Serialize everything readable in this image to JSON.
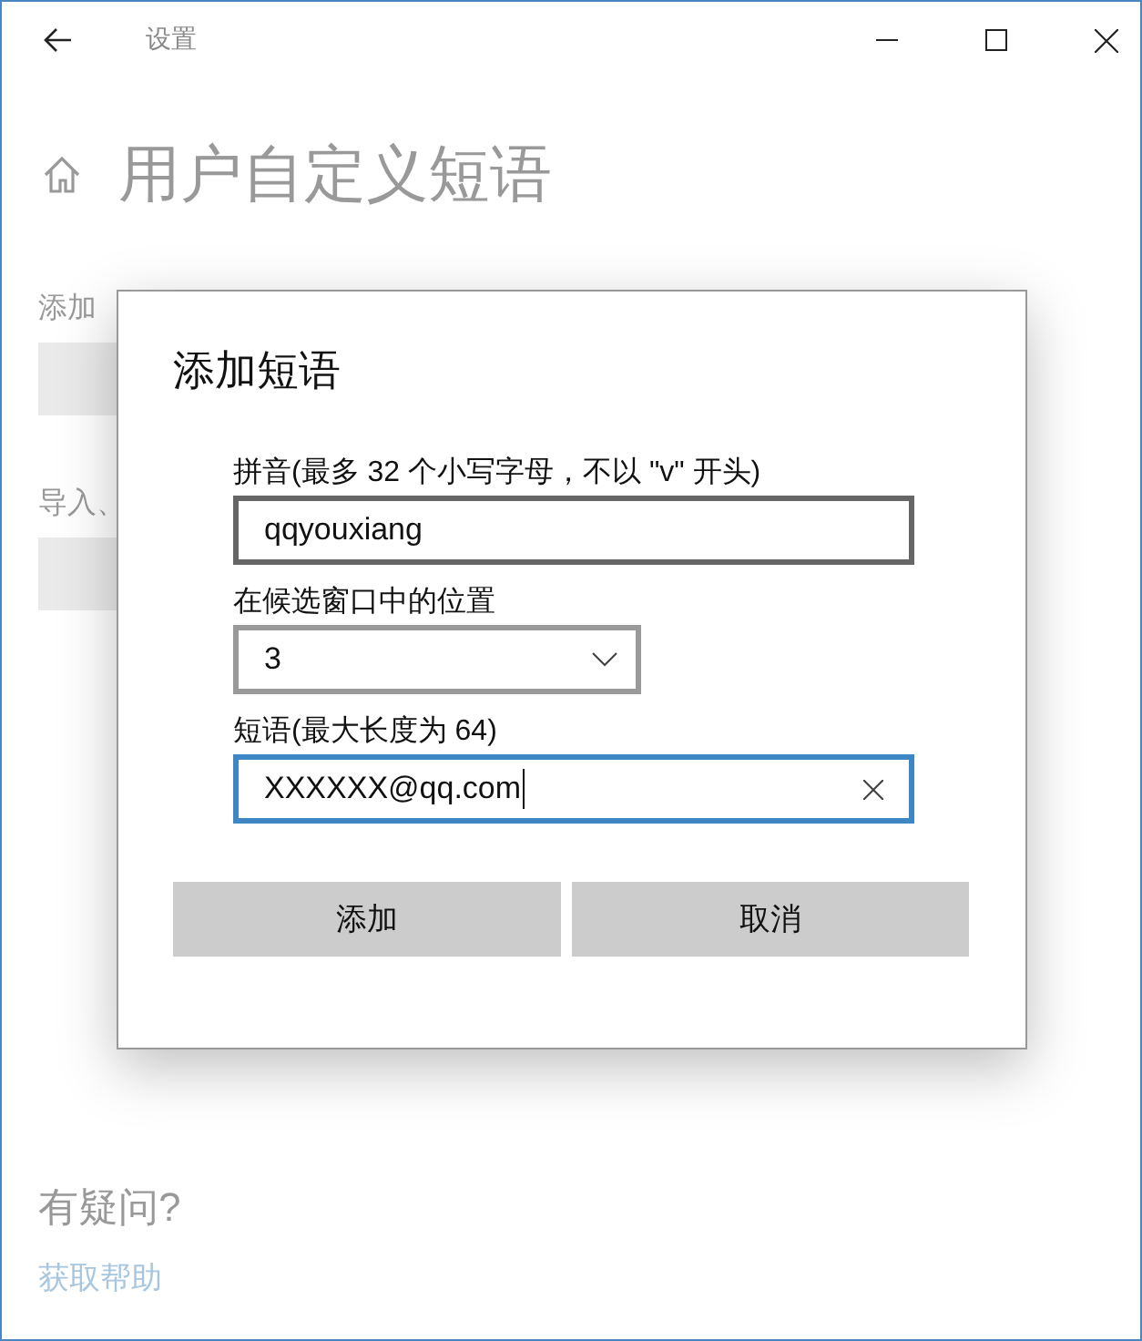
{
  "window": {
    "title": "设置"
  },
  "page": {
    "title": "用户自定义短语",
    "section_1": "添加",
    "section_2": "导入、",
    "help_heading": "有疑问?",
    "help_link": "获取帮助"
  },
  "dialog": {
    "title": "添加短语",
    "fields": [
      {
        "kind": "text",
        "label": "拼音(最多 32 个小写字母，不以 \"v\" 开头)",
        "value": "qqyouxiang",
        "focused": false
      },
      {
        "kind": "dropdown",
        "label": "在候选窗口中的位置",
        "value": "3",
        "focused": false
      },
      {
        "kind": "text",
        "label": "短语(最大长度为 64)",
        "value": "XXXXXX@qq.com",
        "focused": true
      }
    ],
    "buttons": [
      "添加",
      "取消"
    ]
  }
}
